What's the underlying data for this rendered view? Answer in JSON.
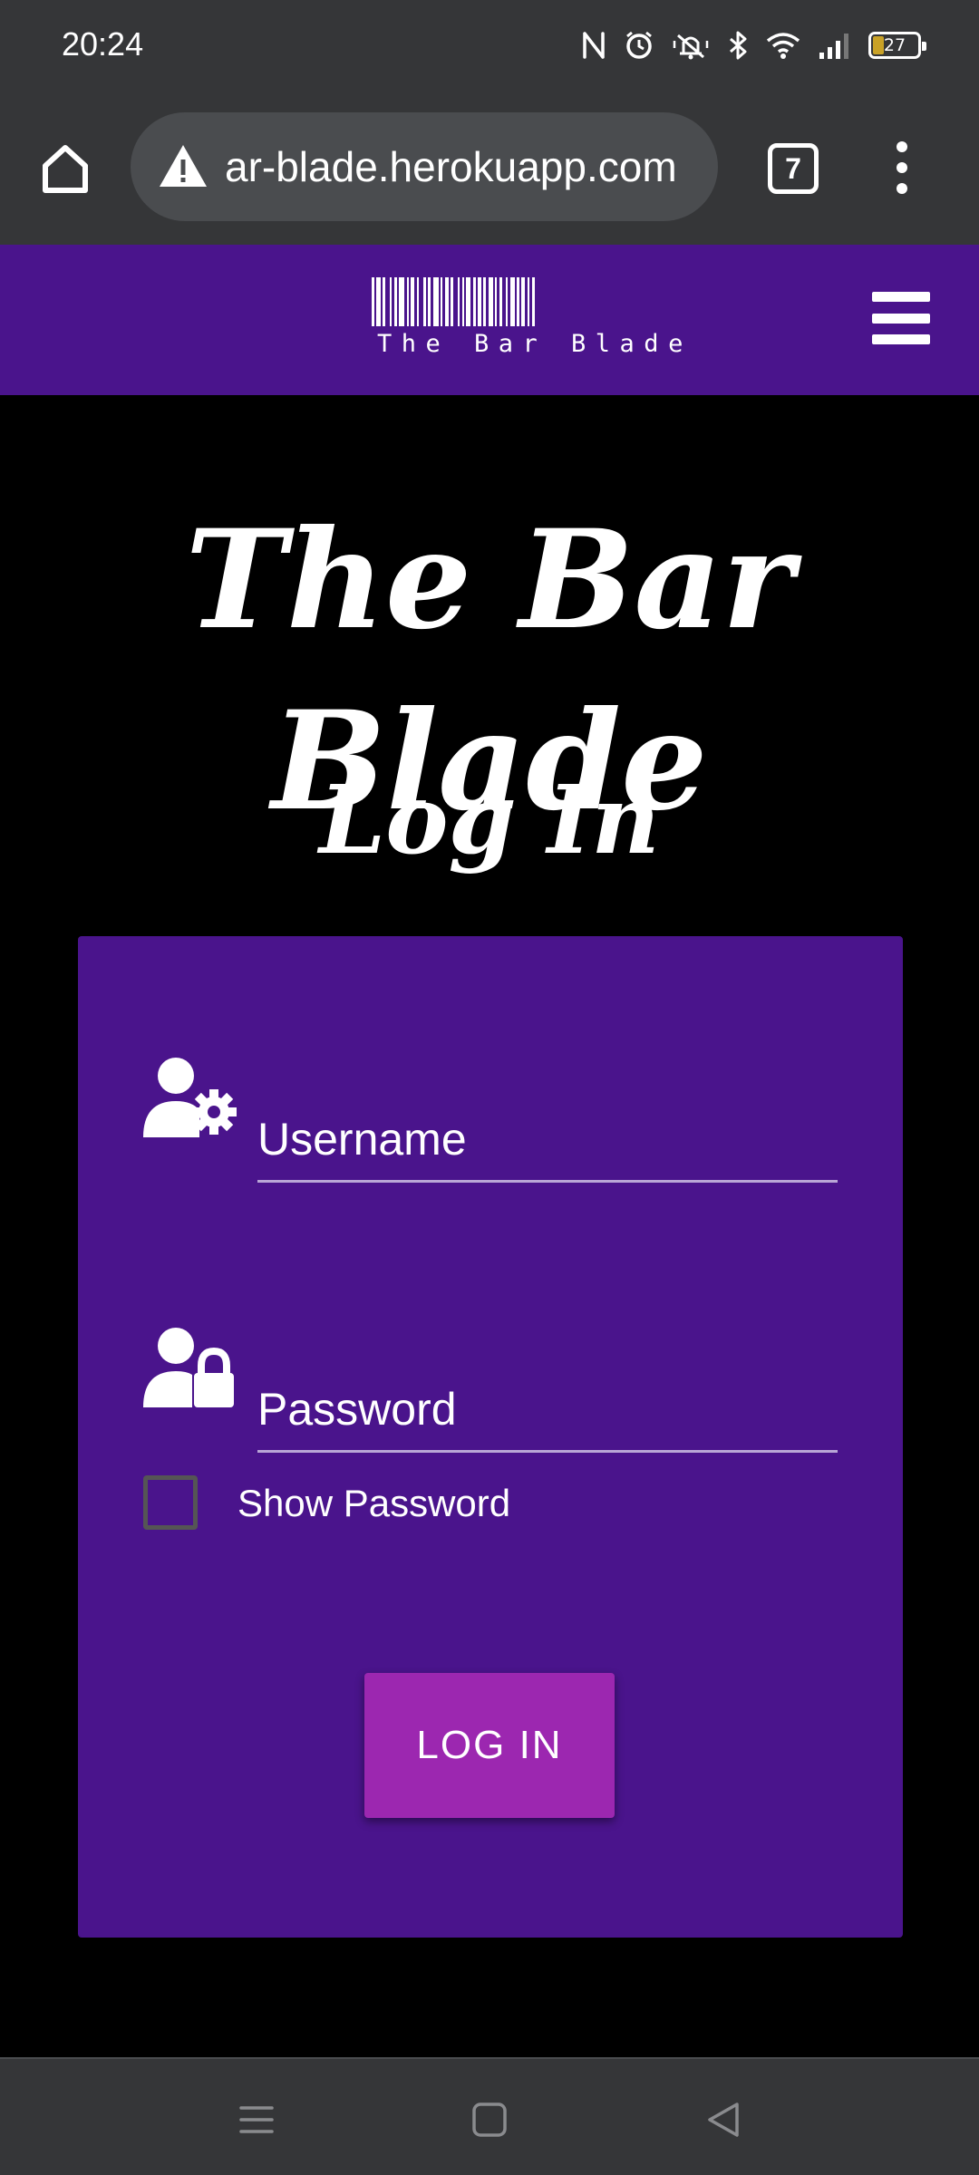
{
  "status_bar": {
    "time": "20:24",
    "battery_level": "27",
    "icons": [
      "nfc-icon",
      "alarm-icon",
      "mute-icon",
      "bluetooth-icon",
      "wifi-icon",
      "signal-icon",
      "battery-icon"
    ]
  },
  "browser": {
    "url": "ar-blade.herokuapp.com",
    "tab_count": "7",
    "security_icon": "warning-triangle-icon"
  },
  "navbar": {
    "logo_text": "The Bar Blade",
    "menu_icon": "hamburger-icon",
    "color": "#4a148c"
  },
  "main": {
    "site_title": "The Bar Blade",
    "page_title": "Log In"
  },
  "login_form": {
    "username_placeholder": "Username",
    "password_placeholder": "Password",
    "show_password_label": "Show Password",
    "show_password_checked": false,
    "submit_label": "LOG IN",
    "button_color": "#9c27b0"
  },
  "system_nav": {
    "buttons": [
      "recents-icon",
      "home-icon",
      "back-icon"
    ]
  }
}
